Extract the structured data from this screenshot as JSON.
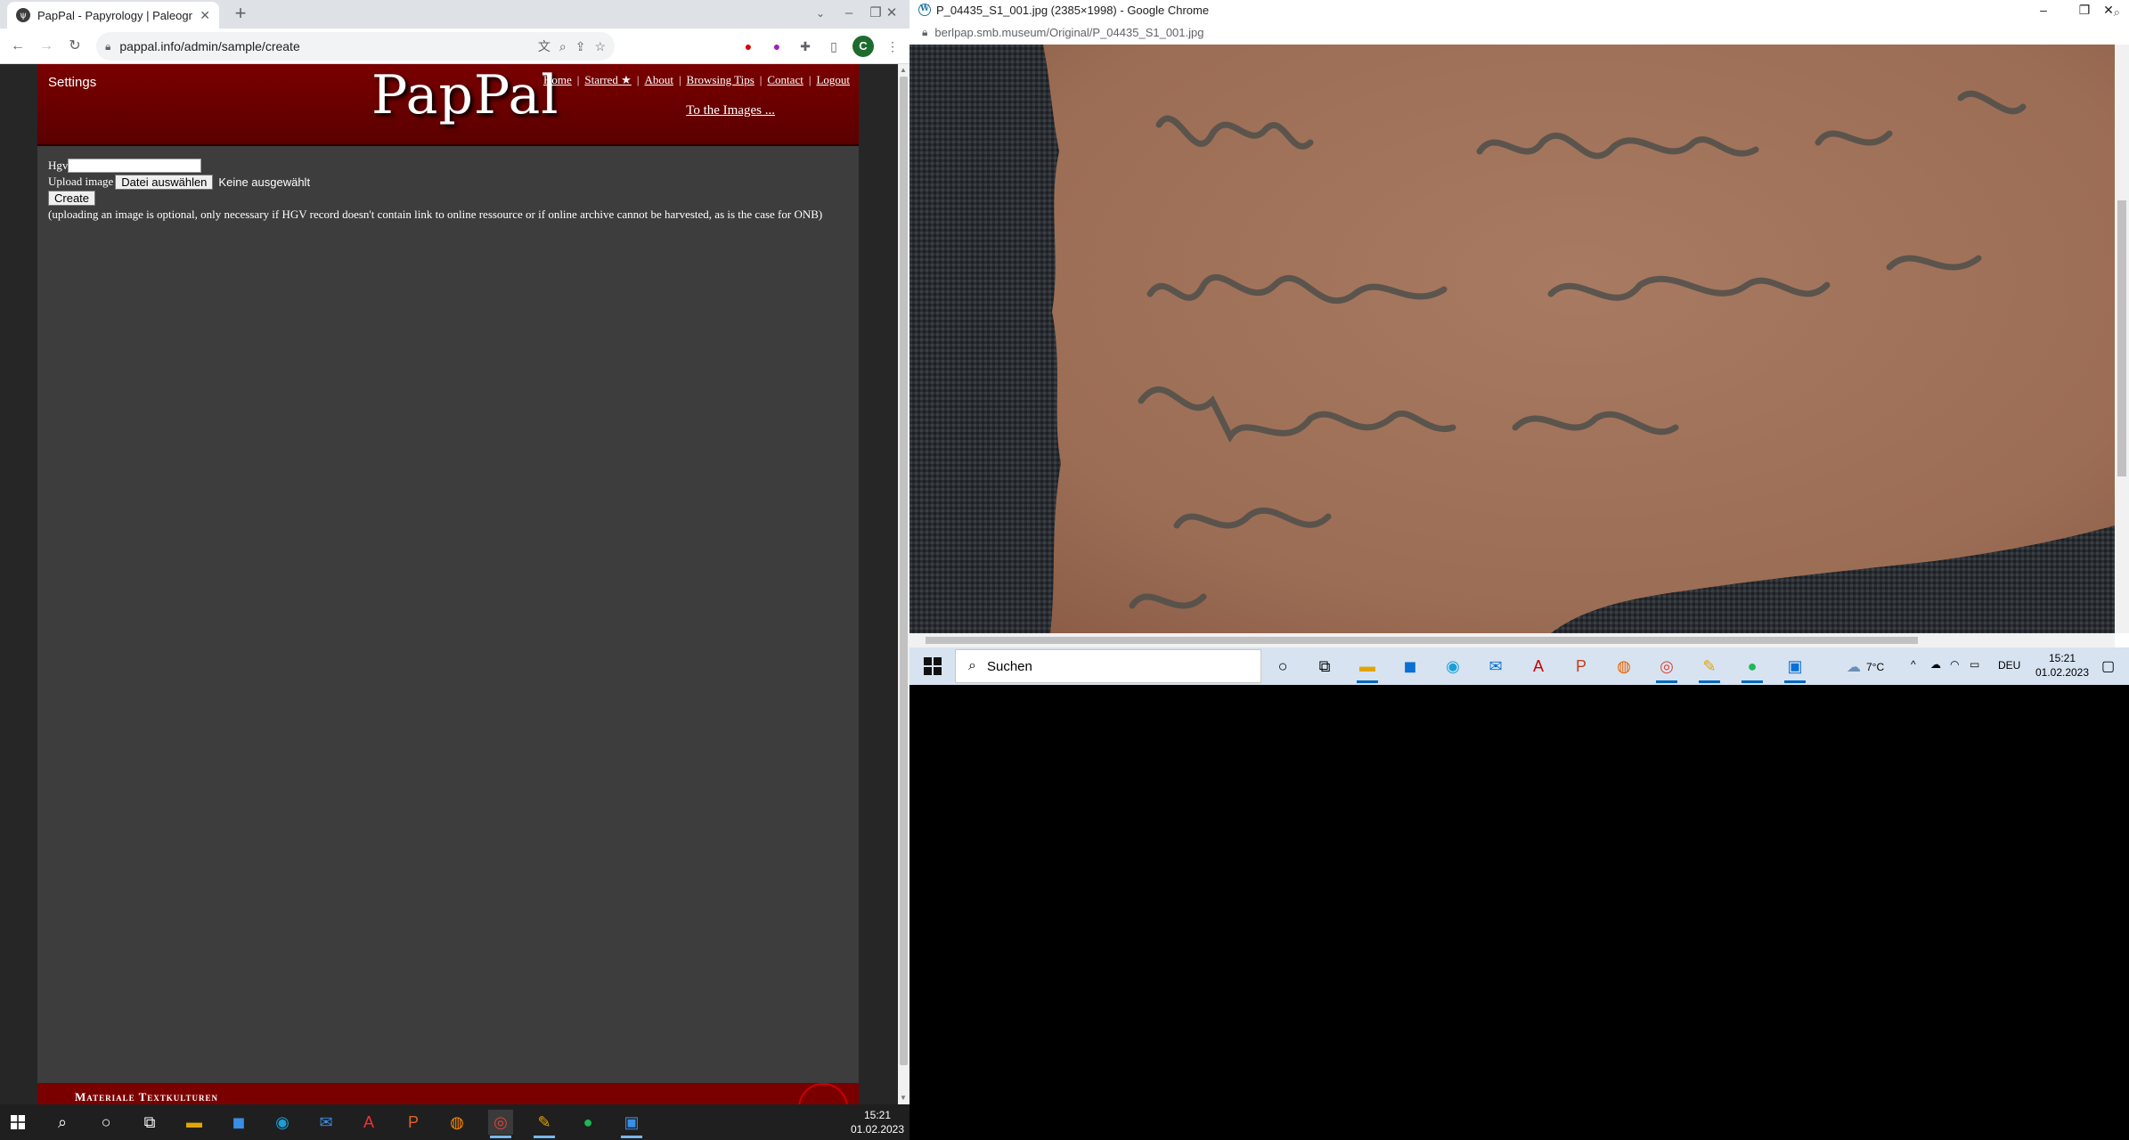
{
  "left_browser": {
    "tab_title": "PapPal - Papyrology | Paleograph",
    "tab_favicon": "ψ",
    "new_tab": "+",
    "url": "pappal.info/admin/sample/create",
    "profile_initial": "C"
  },
  "site": {
    "settings": "Settings",
    "brand": "PapPal",
    "nav": [
      "Home",
      "Starred ★",
      "About",
      "Browsing Tips",
      "Contact",
      "Logout"
    ],
    "nav_separator": "|",
    "to_images": "To the Images ...",
    "form": {
      "hgv_label": "Hgv",
      "hgv_value": "",
      "upload_label": "Upload image",
      "file_button": "Datei auswählen",
      "file_status": "Keine ausgewählt",
      "create_button": "Create",
      "note": "(uploading an image is optional, only necessary if HGV record doesn't contain link to online ressource or if online archive cannot be harvested, as is the case for ONB)"
    },
    "footer_text": "Materiale Textkulturen"
  },
  "right_browser": {
    "window_title": "P_04435_S1_001.jpg (2385×1998) - Google Chrome",
    "url": "berlpap.smb.museum/Original/P_04435_S1_001.jpg"
  },
  "taskbar_right": {
    "search_placeholder": "Suchen",
    "weather": "7°C",
    "language": "DEU",
    "time": "15:21",
    "date": "01.02.2023"
  },
  "taskbar_left": {
    "time": "15:21",
    "date": "01.02.2023"
  },
  "colors": {
    "header_red": "#7a0000",
    "page_gray": "#3d3d3d",
    "papyrus": "#a0725a"
  }
}
